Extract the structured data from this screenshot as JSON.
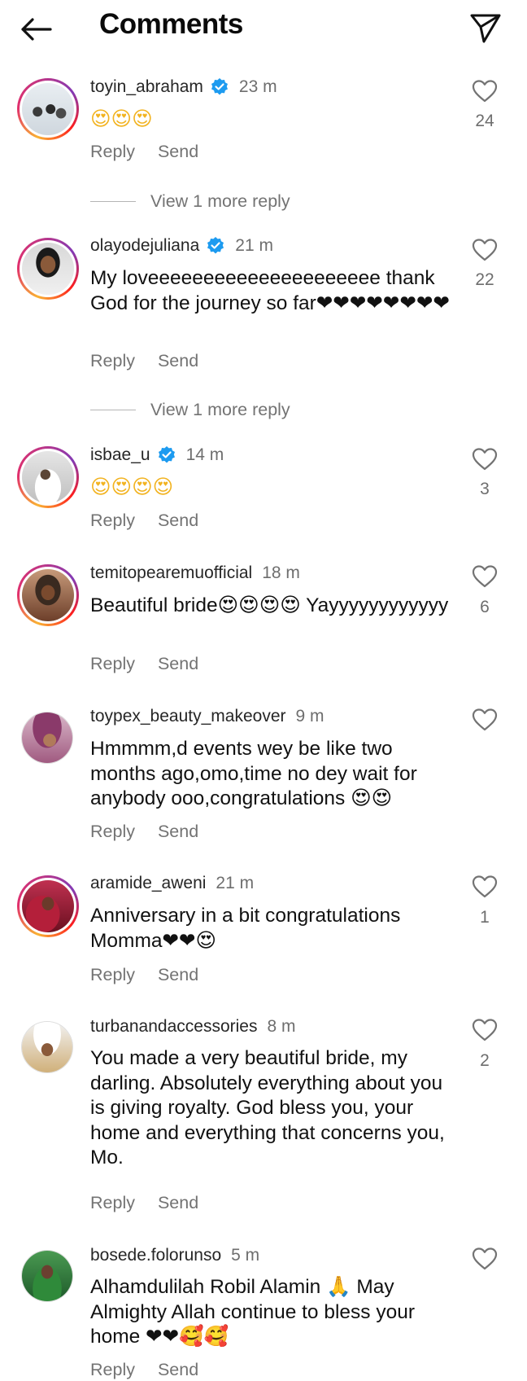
{
  "header": {
    "title": "Comments"
  },
  "colors": {
    "heart": "#e0213b",
    "verified": "#1d9bf0",
    "secondary": "#737373"
  },
  "icons": {
    "back": "arrow-left-icon",
    "share": "paper-plane-icon",
    "like": "heart-outline-icon",
    "verified": "verified-badge-icon"
  },
  "actions": {
    "reply": "Reply",
    "send": "Send"
  },
  "comments": [
    {
      "username": "toyin_abraham",
      "verified": true,
      "time": "23 m",
      "text": "😍😍😍",
      "likes": "24",
      "more_replies": "View 1 more reply"
    },
    {
      "username": "olayodejuliana",
      "verified": true,
      "time": "21 m",
      "text": "My loveeeeeeeeeeeeeeeeeeeee thank God for the journey so far❤❤❤❤❤❤❤❤",
      "likes": "22",
      "more_replies": "View 1 more reply"
    },
    {
      "username": "isbae_u",
      "verified": true,
      "time": "14 m",
      "text": "😍😍😍😍",
      "likes": "3"
    },
    {
      "username": "temitopearemuofficial",
      "verified": false,
      "time": "18 m",
      "text": "Beautiful bride😍😍😍😍 Yayyyyyyyyyyyy",
      "likes": "6"
    },
    {
      "username": "toypex_beauty_makeover",
      "verified": false,
      "time": "9 m",
      "text": "Hmmmm,d events wey be like two months ago,omo,time no dey wait for anybody ooo,congratulations 😍😍",
      "likes": ""
    },
    {
      "username": "aramide_aweni",
      "verified": false,
      "time": "21 m",
      "text": "Anniversary in a bit congratulations Momma❤❤😍",
      "likes": "1"
    },
    {
      "username": "turbanandaccessories",
      "verified": false,
      "time": "8 m",
      "text": "You made a very beautiful bride, my darling.  Absolutely everything about you is giving royalty. God bless you, your home and everything that concerns you, Mo.",
      "likes": "2"
    },
    {
      "username": "bosede.folorunso",
      "verified": false,
      "time": "5 m",
      "text": "Alhamdulilah Robil Alamin 🙏 May Almighty Allah continue to bless your home ❤❤🥰🥰",
      "likes": ""
    }
  ]
}
